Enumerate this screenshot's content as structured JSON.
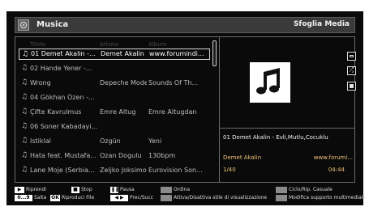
{
  "header": {
    "title": "Musica",
    "browse_label": "Sfoglia Media"
  },
  "columns": {
    "title": "Titolo",
    "artist": "Artista",
    "album": "Album"
  },
  "tracks": [
    {
      "title": "01 Demet Akalin -...",
      "artist": "Demet Akalin",
      "album": "www.forumindi...",
      "selected": true
    },
    {
      "title": "02 Hande Yener -...",
      "artist": "",
      "album": ""
    },
    {
      "title": "Wrong",
      "artist": "Depeche Mode",
      "album": "Sounds Of Th..."
    },
    {
      "title": "04 Gökhan Özen -...",
      "artist": "",
      "album": ""
    },
    {
      "title": "Çifte Kavrulmus",
      "artist": "Emre Altug",
      "album": "Emre Altugdan"
    },
    {
      "title": "06 Soner Kabadayi...",
      "artist": "",
      "album": ""
    },
    {
      "title": "Istiklal",
      "artist": "Özgün",
      "album": "Yeni"
    },
    {
      "title": "Hata feat. Mustafa...",
      "artist": "Ozan Dogulu",
      "album": "130bpm"
    },
    {
      "title": "Lane Moje (Serbia...",
      "artist": "Zeljko Joksimo...",
      "album": "Eurovision Son..."
    }
  ],
  "now_playing": {
    "title": "01 Demet Akalin - Evli,Mutlu,Cocuklu",
    "artist": "Demet Akalin",
    "album": "www.forumi...",
    "position": "1/40",
    "time": "04:44"
  },
  "footer": {
    "play": "Riprendi",
    "stop": "Stop",
    "pause": "Pausa",
    "sort": "Ordina",
    "loop": "Ciclo/Rip. Casuale",
    "jump_key": "0...9",
    "jump": "Salta",
    "ok_key": "OK",
    "play_file": "Riproduci File",
    "prev_next": "Prec/Succ",
    "view_style": "Attiva/Disattiva stile di visualizzazione",
    "multimedia": "Modifica supporto multimediale"
  },
  "colors": {
    "accent": "#f0c27a",
    "background": "#0a0a0a"
  },
  "icons": [
    "app-music-icon",
    "music-note-icon",
    "repeat-icon",
    "shuffle-icon",
    "stop-icon"
  ]
}
